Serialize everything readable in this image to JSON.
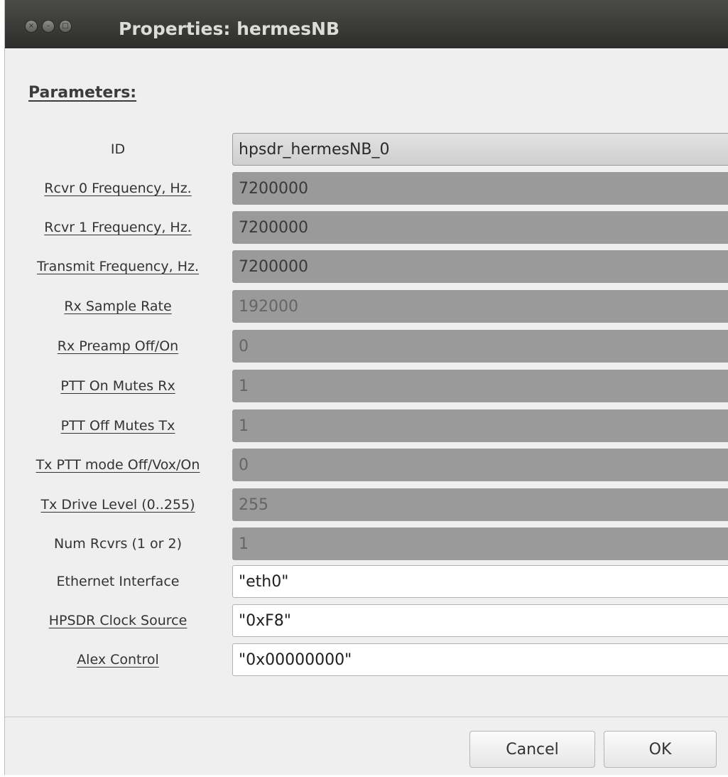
{
  "window": {
    "title": "Properties: hermesNB",
    "close_glyph": "×",
    "minimize_glyph": "–",
    "maximize_glyph": "□"
  },
  "section_title": "Parameters:",
  "params": [
    {
      "label": "ID",
      "value": "hpsdr_hermesNB_0"
    },
    {
      "label": "Rcvr 0 Frequency, Hz.",
      "value": "7200000"
    },
    {
      "label": "Rcvr 1 Frequency, Hz.",
      "value": "7200000"
    },
    {
      "label": "Transmit Frequency, Hz.",
      "value": "7200000"
    },
    {
      "label": "Rx Sample Rate",
      "value": "192000"
    },
    {
      "label": "Rx Preamp Off/On",
      "value": "0"
    },
    {
      "label": "PTT On Mutes Rx",
      "value": "1"
    },
    {
      "label": "PTT Off Mutes Tx",
      "value": "1"
    },
    {
      "label": "Tx PTT mode Off/Vox/On",
      "value": "0"
    },
    {
      "label": "Tx Drive Level (0..255)",
      "value": "255"
    },
    {
      "label": "Num Rcvrs (1 or 2)",
      "value": "1"
    },
    {
      "label": "Ethernet Interface",
      "value": "\"eth0\""
    },
    {
      "label": "HPSDR Clock Source",
      "value": "\"0xF8\""
    },
    {
      "label": "Alex Control",
      "value": "\"0x00000000\""
    }
  ],
  "buttons": {
    "cancel": "Cancel",
    "ok": "OK"
  }
}
